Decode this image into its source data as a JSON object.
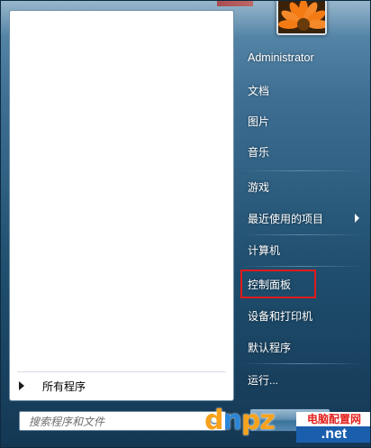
{
  "window": {
    "name": "Windows 7 start menu"
  },
  "user": {
    "name": "Administrator",
    "picture_icon": "flower-user-picture-icon"
  },
  "left_pane": {
    "all_programs_label": "所有程序",
    "search_placeholder": "搜索程序和文件"
  },
  "right_pane": {
    "items": [
      {
        "label": "文档"
      },
      {
        "label": "图片"
      },
      {
        "label": "音乐"
      },
      {
        "label": "游戏"
      },
      {
        "label": "最近使用的项目",
        "has_submenu": true
      },
      {
        "label": "计算机"
      },
      {
        "label": "控制面板",
        "highlighted": true
      },
      {
        "label": "设备和打印机"
      },
      {
        "label": "默认程序"
      },
      {
        "label": "运行..."
      }
    ]
  },
  "annotation": {
    "highlight_color": "#e21a1a"
  },
  "watermark": {
    "logo_left": "d",
    "logo_mid": "n",
    "logo_right": "pz",
    "badge": "电脑配置网",
    "domain": ".net"
  },
  "colors": {
    "frame_top": "#5f8fb0",
    "frame_bottom": "#143854",
    "left_pane": "#ffffff",
    "right_text": "#ffffff"
  }
}
